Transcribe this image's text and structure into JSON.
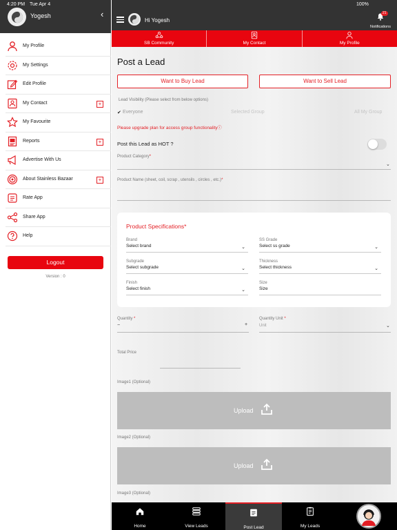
{
  "status_bar": {
    "time": "4:20 PM",
    "date": "Tue Apr 4",
    "battery": "100%"
  },
  "drawer": {
    "user_name": "Yogesh",
    "menu": [
      {
        "label": "My Profile",
        "icon": "person-icon",
        "plus": false
      },
      {
        "label": "My Settings",
        "icon": "settings-icon",
        "plus": false
      },
      {
        "label": "Edit Profile",
        "icon": "edit-icon",
        "plus": false
      },
      {
        "label": "My Contact",
        "icon": "contact-icon",
        "plus": true
      },
      {
        "label": "My Favourite",
        "icon": "star-icon",
        "plus": false
      },
      {
        "label": "Reports",
        "icon": "report-icon",
        "plus": true
      },
      {
        "label": "Advertise With Us",
        "icon": "megaphone-icon",
        "plus": false
      },
      {
        "label": "About Stainless Bazaar",
        "icon": "target-icon",
        "plus": true
      },
      {
        "label": "Rate App",
        "icon": "rate-icon",
        "plus": false
      },
      {
        "label": "Share App",
        "icon": "share-icon",
        "plus": false
      },
      {
        "label": "Help",
        "icon": "help-icon",
        "plus": false
      }
    ],
    "plus_symbol": "+",
    "logout_label": "Logout",
    "version": "Version : 0"
  },
  "header": {
    "greeting": "Hi Yogesh",
    "notifications_label": "Notifications",
    "notifications_count": "21"
  },
  "tabs": [
    {
      "label": "SB Community",
      "icon": "community-icon"
    },
    {
      "label": "My Contact",
      "icon": "contact-card-icon"
    },
    {
      "label": "My Profile",
      "icon": "profile-icon"
    }
  ],
  "form": {
    "title": "Post a Lead",
    "buy_label": "Want to Buy Lead",
    "sell_label": "Want to Sell Lead",
    "visibility_label": "Lead Visibility (Please select from below options)",
    "visibility_options": {
      "everyone": "Everyone",
      "selected_group": "Selected Group",
      "all_my_group": "All My Group"
    },
    "upgrade_note": "Please upgrade plan for access group functionality",
    "hot_label": "Post this Lead as HOT ?",
    "hot_on": false,
    "product_category_label": "Product Category",
    "product_name_label": "Product Name (sheet, coil, scrap , utensils , circles , etc.)",
    "required_mark": "*",
    "specs": {
      "title": "Product Specifications",
      "fields": [
        {
          "label": "Brand",
          "value": "Select brand"
        },
        {
          "label": "SS Grade",
          "value": "Select ss grade"
        },
        {
          "label": "Subgrade",
          "value": "Select subgrade"
        },
        {
          "label": "Thickness",
          "value": "Select thickness"
        },
        {
          "label": "Finish",
          "value": "Select finish"
        },
        {
          "label": "Size",
          "value": "Size"
        }
      ]
    },
    "quantity_label": "Quantity",
    "quantity_minus": "−",
    "quantity_plus": "+",
    "quantity_unit_label": "Quantity Unit",
    "quantity_unit_placeholder": "Unit",
    "total_price_label": "Total Price",
    "images": [
      {
        "label": "Image1 (Optional)",
        "button": "Upload"
      },
      {
        "label": "Image2 (Optional)",
        "button": "Upload"
      },
      {
        "label": "Image3 (Optional)"
      }
    ]
  },
  "bottom_nav": [
    {
      "label": "Home",
      "icon": "home-icon"
    },
    {
      "label": "View Leads",
      "icon": "view-leads-icon"
    },
    {
      "label": "Post Lead",
      "icon": "post-lead-icon",
      "active": true
    },
    {
      "label": "My Leads",
      "icon": "my-leads-icon"
    }
  ],
  "colors": {
    "accent": "#e8050f",
    "header_bg": "#333333",
    "nav_bg": "#000000"
  }
}
